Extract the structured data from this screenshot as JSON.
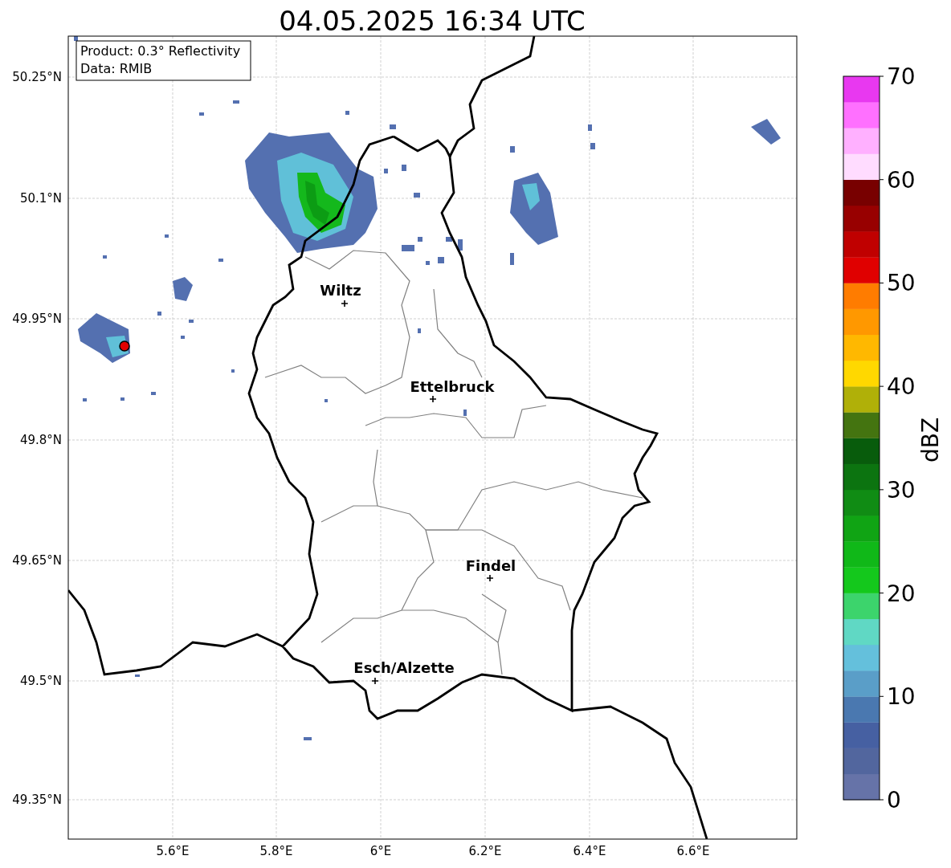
{
  "title": "04.05.2025 16:34 UTC",
  "info_box": [
    "Product: 0.3° Reflectivity",
    "Data: RMIB"
  ],
  "lat_ticks": [
    "50.25°N",
    "50.1°N",
    "49.95°N",
    "49.8°N",
    "49.65°N",
    "49.5°N",
    "49.35°N"
  ],
  "lon_ticks": [
    "5.6°E",
    "5.8°E",
    "6°E",
    "6.2°E",
    "6.4°E",
    "6.6°E"
  ],
  "cities": [
    "Wiltz",
    "Ettelbruck",
    "Findel",
    "Esch/Alzette"
  ],
  "colorbar": {
    "label": "dBZ",
    "ticks": [
      "70",
      "60",
      "50",
      "40",
      "30",
      "20",
      "10",
      "0"
    ],
    "segments": [
      {
        "color": "#6673a8"
      },
      {
        "color": "#52669e"
      },
      {
        "color": "#4660a2"
      },
      {
        "color": "#4a78b0"
      },
      {
        "color": "#5a9ec8"
      },
      {
        "color": "#64c0dc"
      },
      {
        "color": "#60d8c4"
      },
      {
        "color": "#3cd46c"
      },
      {
        "color": "#14c81c"
      },
      {
        "color": "#10b818"
      },
      {
        "color": "#10a414"
      },
      {
        "color": "#108c14"
      },
      {
        "color": "#0c7410"
      },
      {
        "color": "#085c0c"
      },
      {
        "color": "#447410"
      },
      {
        "color": "#b0b008"
      },
      {
        "color": "#ffd800"
      },
      {
        "color": "#ffb800"
      },
      {
        "color": "#ff9800"
      },
      {
        "color": "#ff7c00"
      },
      {
        "color": "#e00000"
      },
      {
        "color": "#c00000"
      },
      {
        "color": "#980000"
      },
      {
        "color": "#780000"
      },
      {
        "color": "#ffdcff"
      },
      {
        "color": "#ffb0ff"
      },
      {
        "color": "#ff70ff"
      },
      {
        "color": "#e838f0"
      }
    ]
  }
}
